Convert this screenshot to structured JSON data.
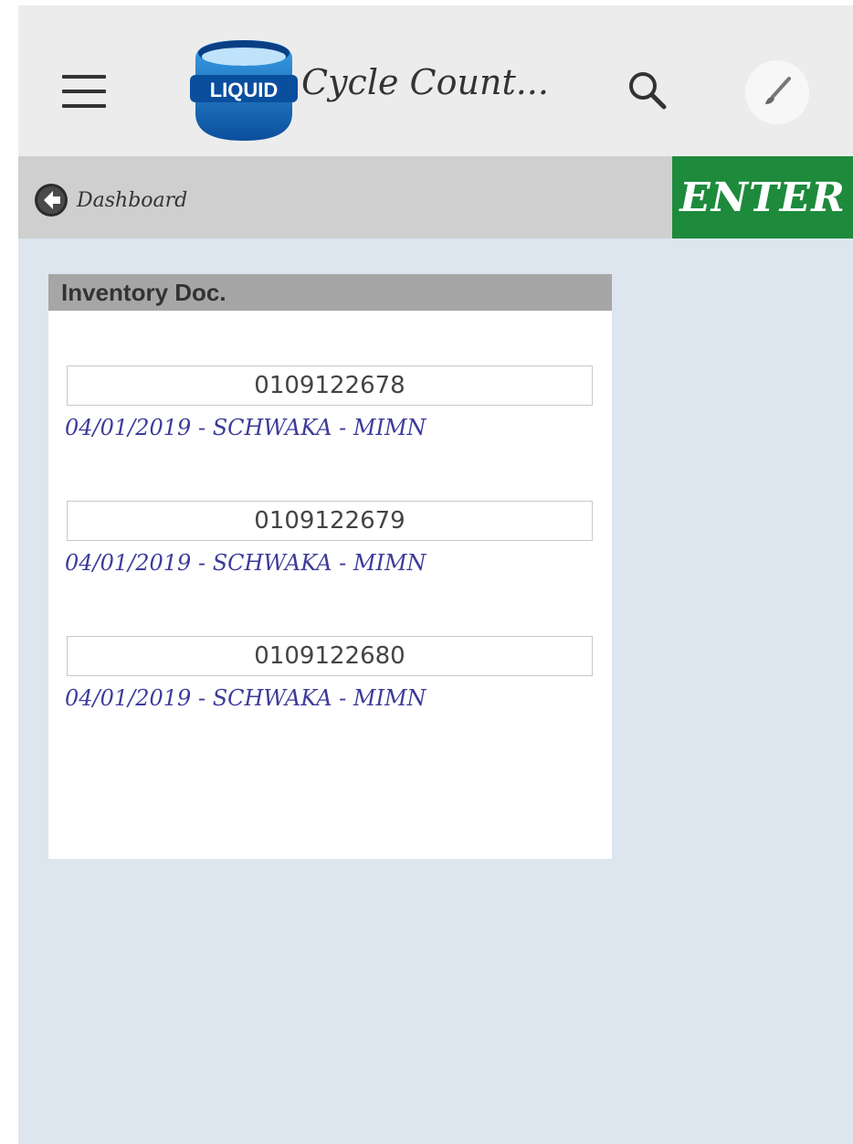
{
  "header": {
    "logo_text": "LIQUID",
    "app_title": "Cycle Count...",
    "menu_icon": "hamburger-menu-icon",
    "search_icon": "search-icon",
    "settings_icon": "paintbrush-icon"
  },
  "subbar": {
    "back_label": "Dashboard",
    "back_icon": "back-arrow-icon",
    "enter_label": "ENTER"
  },
  "panel": {
    "title": "Inventory Doc.",
    "items": [
      {
        "doc_number": "0109122678",
        "details": "04/01/2019 - SCHWAKA - MIMN"
      },
      {
        "doc_number": "0109122679",
        "details": "04/01/2019 - SCHWAKA - MIMN"
      },
      {
        "doc_number": "0109122680",
        "details": "04/01/2019 - SCHWAKA - MIMN"
      }
    ]
  },
  "colors": {
    "header_bg": "#ececec",
    "subbar_bg": "#cfcfcf",
    "enter_bg": "#1e8a3c",
    "content_bg": "#dde6ee",
    "panel_header_bg": "#a6a6a6",
    "detail_text": "#3d3b9a"
  }
}
